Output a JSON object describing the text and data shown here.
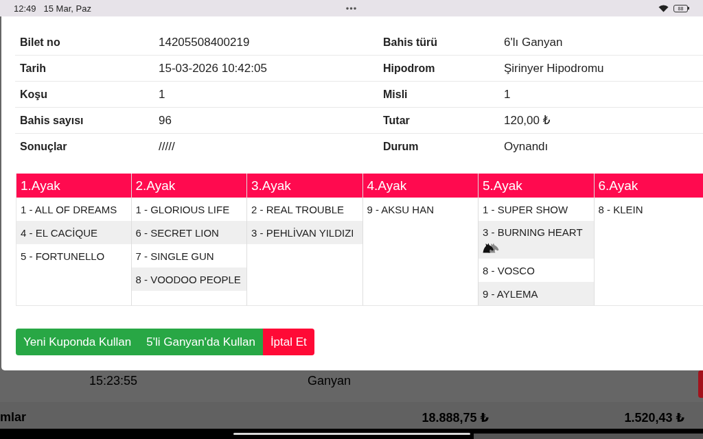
{
  "status_bar": {
    "time": "12:49",
    "date": "15 Mar, Paz",
    "handle": "•••",
    "battery": "88"
  },
  "details": [
    {
      "label": "Bilet no",
      "value": "14205508400219"
    },
    {
      "label": "Bahis türü",
      "value": "6'lı Ganyan"
    },
    {
      "label": "Tarih",
      "value": "15-03-2026 10:42:05"
    },
    {
      "label": "Hipodrom",
      "value": "Şirinyer Hipodromu"
    },
    {
      "label": "Koşu",
      "value": "1"
    },
    {
      "label": "Misli",
      "value": "1"
    },
    {
      "label": "Bahis sayısı",
      "value": "96"
    },
    {
      "label": "Tutar",
      "value": "120,00 ₺"
    },
    {
      "label": "Sonuçlar",
      "value": "/////"
    },
    {
      "label": "Durum",
      "value": "Oynandı"
    }
  ],
  "legs": [
    {
      "title": "1.Ayak",
      "runners": [
        {
          "name": "1 - ALL OF DREAMS",
          "has_icon": false
        },
        {
          "name": "4 - EL CACİQUE",
          "has_icon": false
        },
        {
          "name": "5 - FORTUNELLO",
          "has_icon": false
        }
      ]
    },
    {
      "title": "2.Ayak",
      "runners": [
        {
          "name": "1 - GLORIOUS LIFE",
          "has_icon": false
        },
        {
          "name": "6 - SECRET LION",
          "has_icon": false
        },
        {
          "name": "7 - SINGLE GUN",
          "has_icon": false
        },
        {
          "name": "8 - VOODOO PEOPLE",
          "has_icon": false
        }
      ]
    },
    {
      "title": "3.Ayak",
      "runners": [
        {
          "name": "2 - REAL TROUBLE",
          "has_icon": false
        },
        {
          "name": "3 - PEHLİVAN YILDIZI",
          "has_icon": false
        }
      ]
    },
    {
      "title": "4.Ayak",
      "runners": [
        {
          "name": "9 - AKSU HAN",
          "has_icon": false
        }
      ]
    },
    {
      "title": "5.Ayak",
      "runners": [
        {
          "name": "1 - SUPER SHOW",
          "has_icon": false
        },
        {
          "name": "3 - BURNING HEART",
          "has_icon": true
        },
        {
          "name": "8 - VOSCO",
          "has_icon": false
        },
        {
          "name": "9 - AYLEMA",
          "has_icon": false
        }
      ]
    },
    {
      "title": "6.Ayak",
      "runners": [
        {
          "name": "8 - KLEIN",
          "has_icon": false
        }
      ]
    }
  ],
  "actions": [
    {
      "label": "Yeni Kuponda Kullan",
      "kind": "success"
    },
    {
      "label": "5'li Ganyan'da Kullan",
      "kind": "success"
    },
    {
      "label": "İptal Et",
      "kind": "danger"
    }
  ],
  "background": {
    "row": {
      "time": "15:23:55",
      "bet_type": "Ganyan"
    },
    "totals": {
      "label": "mlar",
      "amount_1": "18.888,75 ₺",
      "amount_2": "1.520,43 ₺"
    }
  }
}
